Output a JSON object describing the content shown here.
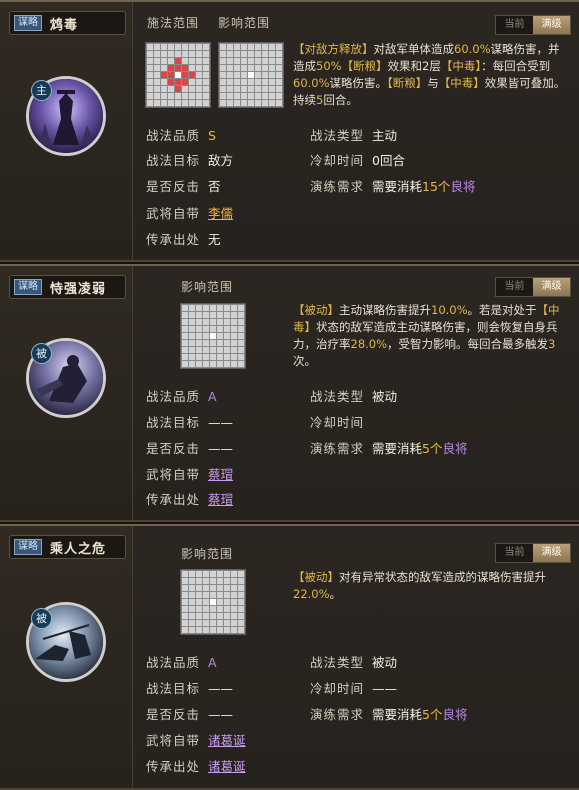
{
  "cards": [
    {
      "tag": "谋略",
      "name": "鸩毒",
      "badge": "主",
      "cast_range_title": "施法范围",
      "effect_range_title": "影响范围",
      "mode_current": "当前",
      "mode_max": "满级",
      "desc": [
        {
          "t": "【对敌方释放】",
          "c": "y"
        },
        {
          "t": "对敌军单体造成",
          "c": ""
        },
        {
          "t": "60.0%",
          "c": "y"
        },
        {
          "t": "谋略伤害，并造成",
          "c": ""
        },
        {
          "t": "50%",
          "c": "y"
        },
        {
          "t": "【断粮】",
          "c": "y"
        },
        {
          "t": "效果和2层",
          "c": ""
        },
        {
          "t": "【中毒】",
          "c": "y"
        },
        {
          "t": "：每回合受到",
          "c": ""
        },
        {
          "t": "60.0%",
          "c": "y"
        },
        {
          "t": "谋略伤害。",
          "c": ""
        },
        {
          "t": "【断粮】",
          "c": "y"
        },
        {
          "t": "与",
          "c": ""
        },
        {
          "t": "【中毒】",
          "c": "y"
        },
        {
          "t": "效果皆可叠加。持续",
          "c": ""
        },
        {
          "t": "5",
          "c": "y"
        },
        {
          "t": "回合。",
          "c": ""
        }
      ],
      "quality_label": "战法品质",
      "quality": "S",
      "target_label": "战法目标",
      "target": "敌方",
      "counter_label": "是否反击",
      "counter": "否",
      "hero_label": "武将自带",
      "hero": "李儒",
      "inherit_label": "传承出处",
      "inherit": "无",
      "type_label": "战法类型",
      "type": "主动",
      "cd_label": "冷却时间",
      "cd": "0回合",
      "drill_label": "演练需求",
      "drill_prefix": "需要消耗",
      "drill_count": "15个",
      "drill_suffix": "良将"
    },
    {
      "tag": "谋略",
      "name": "恃强凌弱",
      "badge": "被",
      "effect_range_title": "影响范围",
      "mode_current": "当前",
      "mode_max": "满级",
      "desc": [
        {
          "t": "【被动】",
          "c": "y"
        },
        {
          "t": "主动谋略伤害提升",
          "c": ""
        },
        {
          "t": "10.0%",
          "c": "y"
        },
        {
          "t": "。若是对处于",
          "c": ""
        },
        {
          "t": "【中毒】",
          "c": "y"
        },
        {
          "t": "状态的敌军造成主动谋略伤害，则会恢复自身兵力，治疗率",
          "c": ""
        },
        {
          "t": "28.0%",
          "c": "y"
        },
        {
          "t": "，受智力影响。每回合最多触发",
          "c": ""
        },
        {
          "t": "3",
          "c": "y"
        },
        {
          "t": "次。",
          "c": ""
        }
      ],
      "quality_label": "战法品质",
      "quality": "A",
      "target_label": "战法目标",
      "target": "——",
      "counter_label": "是否反击",
      "counter": "——",
      "hero_label": "武将自带",
      "hero": "蔡瑁",
      "inherit_label": "传承出处",
      "inherit": "蔡瑁",
      "type_label": "战法类型",
      "type": "被动",
      "cd_label": "冷却时间",
      "cd": "",
      "drill_label": "演练需求",
      "drill_prefix": "需要消耗",
      "drill_count": "5个",
      "drill_suffix": "良将"
    },
    {
      "tag": "谋略",
      "name": "乘人之危",
      "badge": "被",
      "effect_range_title": "影响范围",
      "mode_current": "当前",
      "mode_max": "满级",
      "desc": [
        {
          "t": "【被动】",
          "c": "y"
        },
        {
          "t": "对有异常状态的敌军造成的谋略伤害提升",
          "c": ""
        },
        {
          "t": "22.0%",
          "c": "y"
        },
        {
          "t": "。",
          "c": ""
        }
      ],
      "quality_label": "战法品质",
      "quality": "A",
      "target_label": "战法目标",
      "target": "——",
      "counter_label": "是否反击",
      "counter": "——",
      "hero_label": "武将自带",
      "hero": "诸葛诞",
      "inherit_label": "传承出处",
      "inherit": "诸葛诞",
      "type_label": "战法类型",
      "type": "被动",
      "cd_label": "冷却时间",
      "cd": "——",
      "drill_label": "演练需求",
      "drill_prefix": "需要消耗",
      "drill_count": "5个",
      "drill_suffix": "良将"
    }
  ]
}
